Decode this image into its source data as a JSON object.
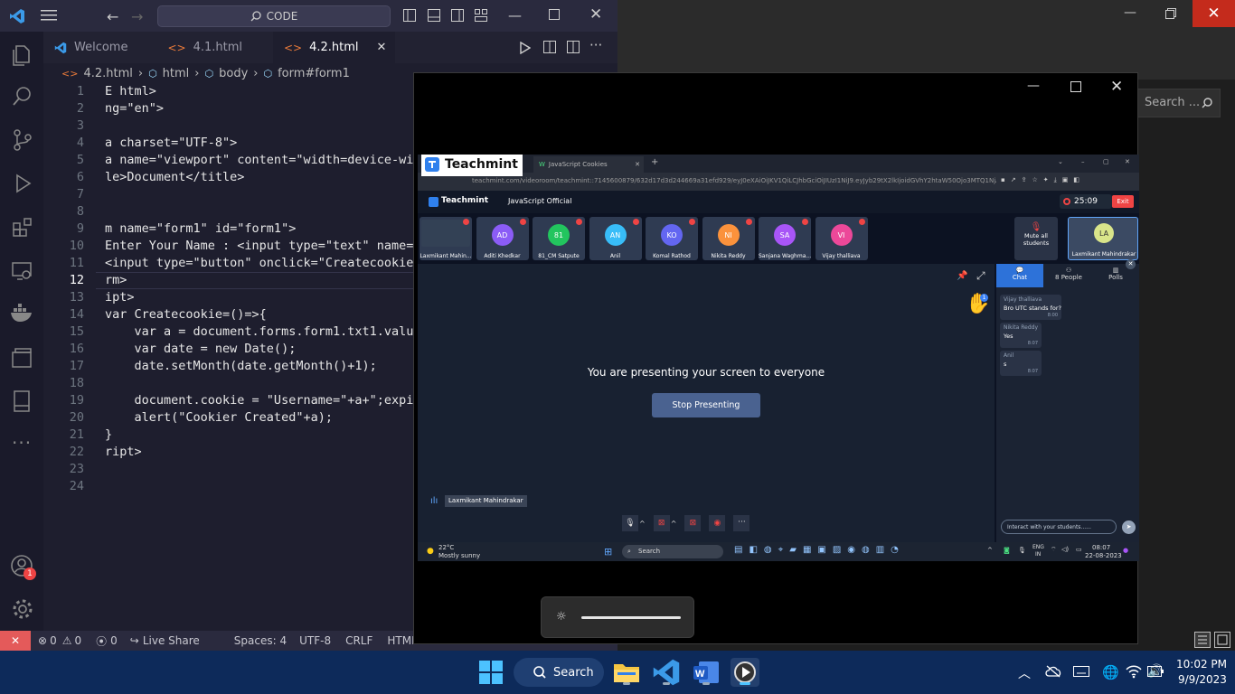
{
  "vscode": {
    "search_placeholder": "CODE",
    "tabs": [
      {
        "label": "Welcome"
      },
      {
        "label": "4.1.html"
      },
      {
        "label": "4.2.html"
      }
    ],
    "breadcrumb": [
      "4.2.html",
      "html",
      "body",
      "form#form1"
    ],
    "lines": [
      {
        "n": "1",
        "t": "E html>"
      },
      {
        "n": "2",
        "t": "ng=\"en\">"
      },
      {
        "n": "3",
        "t": ""
      },
      {
        "n": "4",
        "t": "a charset=\"UTF-8\">"
      },
      {
        "n": "5",
        "t": "a name=\"viewport\" content=\"width=device-width"
      },
      {
        "n": "6",
        "t": "le>Document</title>"
      },
      {
        "n": "7",
        "t": ""
      },
      {
        "n": "8",
        "t": ""
      },
      {
        "n": "9",
        "t": "m name=\"form1\" id=\"form1\">"
      },
      {
        "n": "10",
        "t": "Enter Your Name : <input type=\"text\" name=\"tx"
      },
      {
        "n": "11",
        "t": "<input type=\"button\" onclick=\"Createcookie()\""
      },
      {
        "n": "12",
        "t": "rm>"
      },
      {
        "n": "13",
        "t": "ipt>"
      },
      {
        "n": "14",
        "t": "var Createcookie=()=>{"
      },
      {
        "n": "15",
        "t": "    var a = document.forms.form1.txt1.value;"
      },
      {
        "n": "16",
        "t": "    var date = new Date();"
      },
      {
        "n": "17",
        "t": "    date.setMonth(date.getMonth()+1);"
      },
      {
        "n": "18",
        "t": ""
      },
      {
        "n": "19",
        "t": "    document.cookie = \"Username=\"+a+\";expires"
      },
      {
        "n": "20",
        "t": "    alert(\"Cookier Created\"+a);"
      },
      {
        "n": "21",
        "t": "}"
      },
      {
        "n": "22",
        "t": "ript>"
      },
      {
        "n": "23",
        "t": ""
      },
      {
        "n": "24",
        "t": ""
      }
    ],
    "status": {
      "errors": "0",
      "warnings": "0",
      "ports": "0",
      "live_share": "Live Share",
      "spaces": "Spaces: 4",
      "encoding": "UTF-8",
      "eol": "CRLF",
      "language": "HTML"
    },
    "accounts_badge": "1"
  },
  "background_window": {
    "search_placeholder": "Search ..."
  },
  "player": {
    "logo_overlay": "Teachmint",
    "browser_tabs": [
      "JavaScript Cookies"
    ],
    "url": "teachmint.com/videoroom/teachmint::7145600879/632d17d3d244669a31efd929/eyJ0eXAiOiJKV1QiLCJhbGciOiJIUzI1NiJ9.eyJyb29tX2lkIjoidGVhY2htaW50Ojo3MTQ1NjA...",
    "app_name": "Teachmint",
    "class_name": "JavaScript Official",
    "timer": "25:09",
    "exit_label": "Exit",
    "participants": [
      {
        "initials": "",
        "name": "Laxmikant Mahin...",
        "color": "#334155"
      },
      {
        "initials": "AD",
        "name": "Aditi Khedkar",
        "color": "#8b5cf6"
      },
      {
        "initials": "81",
        "name": "81_CM Satpute",
        "color": "#22c55e"
      },
      {
        "initials": "AN",
        "name": "Anil",
        "color": "#38bdf8"
      },
      {
        "initials": "KO",
        "name": "Komal Rathod",
        "color": "#6366f1"
      },
      {
        "initials": "NI",
        "name": "Nikita Reddy",
        "color": "#fb923c"
      },
      {
        "initials": "SA",
        "name": "Sanjana Waghma...",
        "color": "#a855f7"
      },
      {
        "initials": "VI",
        "name": "Vijay thalliava",
        "color": "#ec4899"
      }
    ],
    "mute_all": [
      "Mute all",
      "students"
    ],
    "self_tile": {
      "initials": "LA",
      "name": "Laxmikant Mahindrakar"
    },
    "hand_count": "1",
    "presenting_text": "You are presenting your screen to everyone",
    "stop_button": "Stop Presenting",
    "speaker_name": "Laxmikant Mahindrakar",
    "chat_tabs": [
      "Chat",
      "8 People",
      "Polls"
    ],
    "messages": [
      {
        "sender": "Vijay thalliava",
        "text": "Bro UTC stands for?",
        "time": "8:00"
      },
      {
        "sender": "Nikita Reddy",
        "text": "Yes",
        "time": "8:07"
      },
      {
        "sender": "Anil",
        "text": "s",
        "time": "8:07"
      }
    ],
    "chat_placeholder": "Interact with your students......",
    "inner_taskbar": {
      "temp": "22°C",
      "weather": "Mostly sunny",
      "search": "Search",
      "lang1": "ENG",
      "lang2": "IN",
      "time": "08:07",
      "date": "22-08-2023"
    }
  },
  "taskbar": {
    "search_label": "Search",
    "time": "10:02 PM",
    "date": "9/9/2023"
  }
}
